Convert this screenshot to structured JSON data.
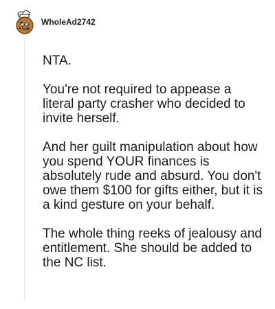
{
  "comment": {
    "username": "WholeAd2742",
    "paragraphs": [
      "NTA.",
      "You're not required to appease a literal party crasher who decided to invite herself.",
      "And her guilt manipulation about how you spend YOUR finances is absolutely rude and absurd. You don't owe them $100 for gifts either, but it is a kind gesture on your behalf.",
      "The whole thing reeks of jealousy and entitlement. She should be added to the NC list."
    ]
  }
}
